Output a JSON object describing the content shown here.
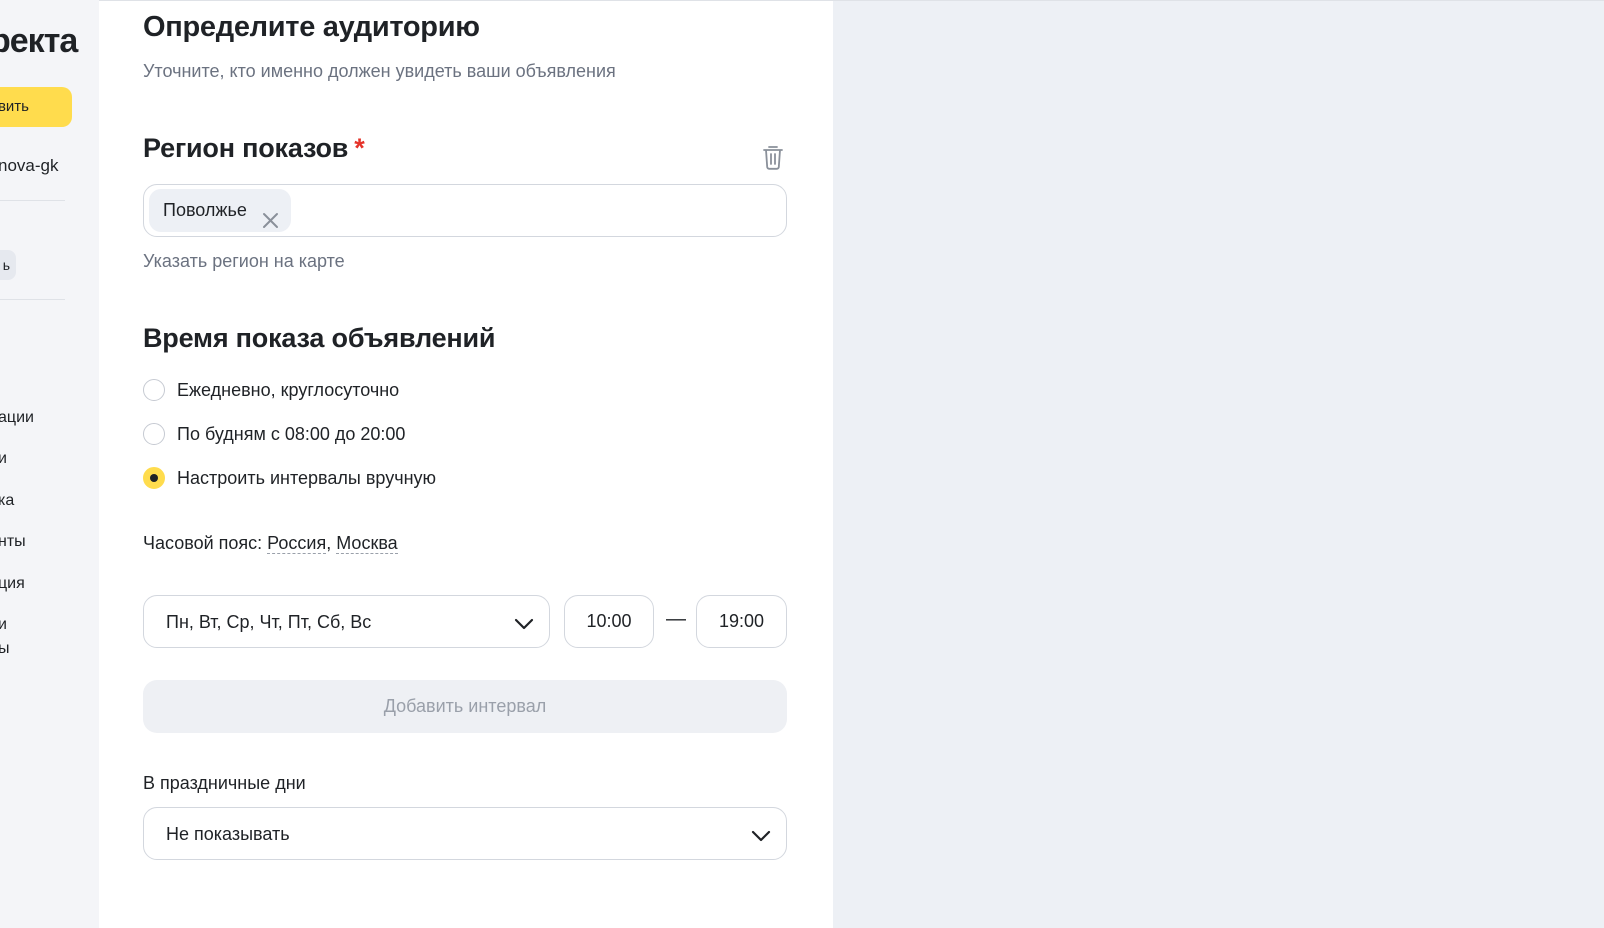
{
  "sidebar": {
    "logo_text": "ректа",
    "create_button_label": "вить",
    "login": "nova-gk",
    "pill_label": "ь",
    "items": [
      {
        "label": "ации"
      },
      {
        "label": "и"
      },
      {
        "label": "ка"
      },
      {
        "label": "нты"
      },
      {
        "label": "ция"
      },
      {
        "label": "и"
      },
      {
        "label": "ы"
      }
    ]
  },
  "audience": {
    "title": "Определите аудиторию",
    "subtitle": "Уточните, кто именно должен увидеть ваши объявления"
  },
  "region": {
    "title": "Регион показов",
    "required_mark": "*",
    "chips": [
      {
        "label": "Поволжье"
      }
    ],
    "map_link": "Указать регион на карте"
  },
  "schedule": {
    "title": "Время показа объявлений",
    "options": [
      {
        "label": "Ежедневно, круглосуточно",
        "checked": false
      },
      {
        "label": "По будням с 08:00 до 20:00",
        "checked": false
      },
      {
        "label": "Настроить интервалы вручную",
        "checked": true
      }
    ],
    "timezone_label": "Часовой пояс:",
    "timezone_country": "Россия",
    "timezone_separator": ",",
    "timezone_city": "Москва",
    "interval": {
      "days": "Пн, Вт, Ср, Чт, Пт, Сб, Вс",
      "from": "10:00",
      "dash": "—",
      "to": "19:00"
    },
    "add_interval_label": "Добавить интервал",
    "holidays_label": "В праздничные дни",
    "holidays_value": "Не показывать"
  },
  "colors": {
    "accent_yellow": "#ffdc4d",
    "required_red": "#e5332a",
    "background": "#edf0f5"
  },
  "icons": [
    "trash-icon",
    "close-icon",
    "chevron-down-icon"
  ]
}
